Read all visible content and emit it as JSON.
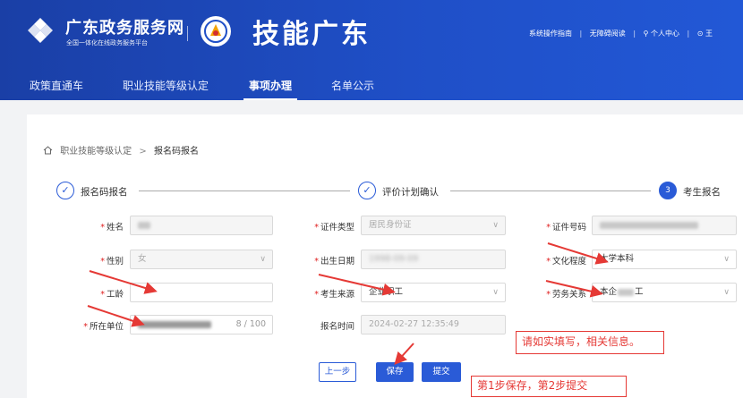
{
  "header": {
    "brand_title": "广东政务服务网",
    "brand_subtitle": "全国一体化在线政务服务平台",
    "site_title": "技能广东",
    "top_links": [
      "系统操作指南",
      "|",
      "无障碍阅读",
      "|",
      "⚲ 个人中心",
      "|",
      "⊙ 王"
    ]
  },
  "nav": {
    "items": [
      "政策直通车",
      "职业技能等级认定",
      "事项办理",
      "名单公示"
    ],
    "active": "事项办理"
  },
  "breadcrumb": {
    "parent": "职业技能等级认定",
    "separator": ">",
    "current": "报名码报名"
  },
  "steps": [
    {
      "label": "报名码报名",
      "mark": "✓"
    },
    {
      "label": "评价计划确认",
      "mark": "✓"
    },
    {
      "label": "考生报名",
      "mark": "3"
    }
  ],
  "form": {
    "name_label": "姓名",
    "gender_label": "性别",
    "gender_value": "女",
    "seniority_label": "工龄",
    "employer_label": "所在单位",
    "employer_counter": "8 / 100",
    "id_type_label": "证件类型",
    "id_type_value": "居民身份证",
    "birth_label": "出生日期",
    "birth_value": "1998-09-09",
    "source_label": "考生来源",
    "source_value": "企业职工",
    "signup_time_label": "报名时间",
    "signup_time_value": "2024-02-27 12:35:49",
    "id_number_label": "证件号码",
    "education_label": "文化程度",
    "education_value": "大学本科",
    "labor_label": "劳务关系",
    "labor_value": "本企",
    "labor_value_suffix": "工"
  },
  "buttons": {
    "prev": "上一步",
    "save": "保存",
    "submit": "提交"
  },
  "notes": {
    "fill_truthfully": "请如实填写，相关信息。",
    "steps_hint": "第1步保存，第2步提交"
  },
  "colors": {
    "header_blue": "#1f4fc7",
    "accent": "#2a5bd7",
    "required": "#e02020",
    "annotation_red": "#e53935"
  }
}
